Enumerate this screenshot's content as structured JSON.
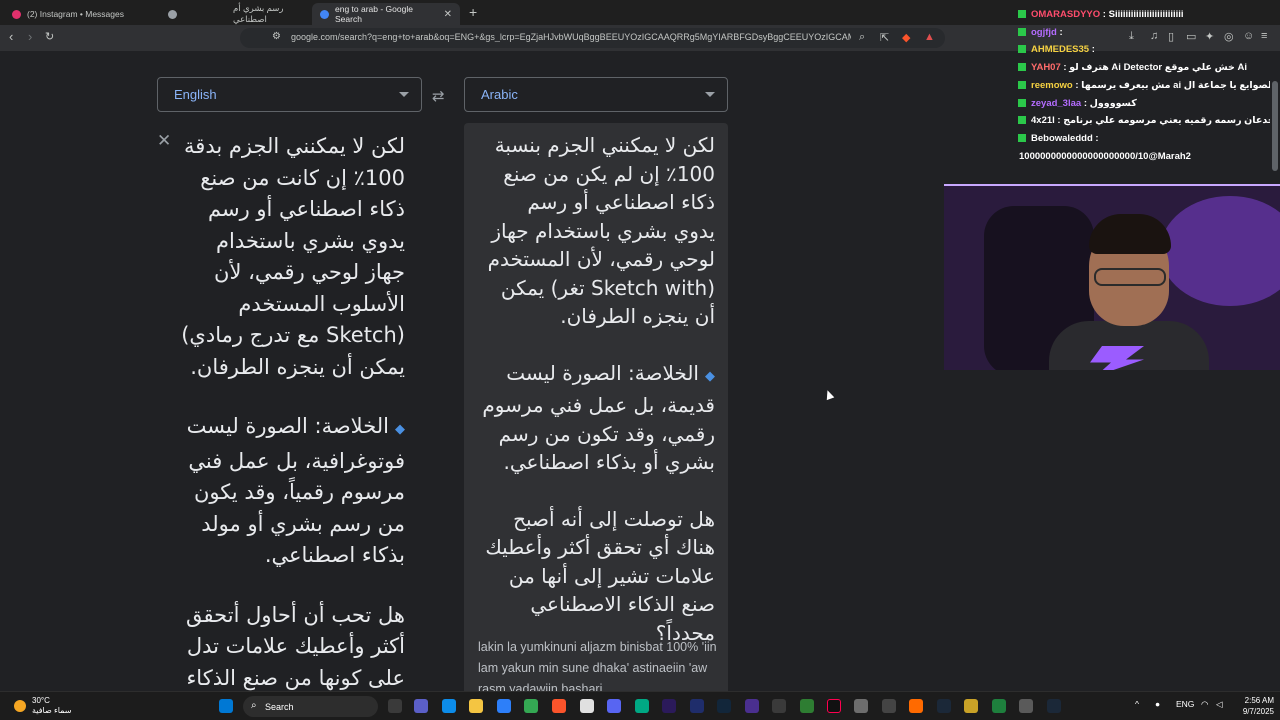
{
  "browser": {
    "tabs": [
      {
        "label": "(2) Instagram • Messages",
        "active": false,
        "favicon_color": "#e1306c"
      },
      {
        "label": "رسم بشري أم اصطناعي",
        "active": false,
        "favicon_color": "#9aa0a6"
      },
      {
        "label": "eng to arab - Google Search",
        "active": true,
        "favicon_color": "#4285f4"
      }
    ],
    "url": "google.com/search?q=eng+to+arab&oq=ENG+&gs_lcrp=EgZjaHJvbWUqBggBEEUYOzIGCAAQRRg5MgYIARBFGDsyBggCEEUYOzIGCAMQRRg7..."
  },
  "translator": {
    "source_lang": "English",
    "target_lang": "Arabic",
    "source_paragraphs": [
      "لكن لا يمكنني الجزم بدقة 100٪ إن كانت من صنع ذكاء اصطناعي أو رسم يدوي بشري باستخدام جهاز لوحي رقمي، لأن الأسلوب المستخدم (Sketch مع تدرج رمادي) يمكن أن ينجزه الطرفان.",
      "الخلاصة: الصورة ليست فوتوغرافية، بل عمل فني مرسوم رقمياً، وقد يكون من رسم بشري أو مولد بذكاء اصطناعي.",
      "هل تحب أن أحاول أتحقق أكثر وأعطيك علامات تدل على كونها من صنع الذكاء"
    ],
    "target_paragraphs": [
      "لكن لا يمكنني الجزم بنسبة 100٪ إن لم يكن من صنع ذكاء اصطناعي أو رسم يدوي بشري باستخدام جهاز لوحي رقمي، لأن المستخدم (Sketch with تغر) يمكن أن ينجزه الطرفان.",
      "الخلاصة: الصورة ليست قديمة، بل عمل فني مرسوم رقمي، وقد تكون من رسم بشري أو بذكاء اصطناعي.",
      "هل توصلت إلى أنه أصبح هناك أي تحقق أكثر وأعطيك علامات تشير إلى أنها من صنع الذكاء الاصطناعي محدداً؟"
    ],
    "transliteration": "lakin la yumkinuni aljazm binisbat 100% 'iin lam yakun min sune dhaka' astinaeiin 'aw rasm yadawiin bashari"
  },
  "chat": [
    {
      "user": "OMARASDYYO",
      "message": "Siiiiiiiiiiiiiiiiiiiiiiiiii",
      "color": "#ff4d6d"
    },
    {
      "user": "ogjfjd",
      "message": "",
      "color": "#b46cff"
    },
    {
      "user": "AHMEDES35",
      "message": "",
      "color": "#f5d142"
    },
    {
      "user": "YAH07",
      "message": "هترف لو Ai Detector خش علي موقع Ai",
      "color": "#ff6b6b"
    },
    {
      "user": "reemowo",
      "message": "مش بيعرف يرسمها ai الصوايع يا جماعة ال",
      "color": "#f5d142"
    },
    {
      "user": "zeyad_3laa",
      "message": "كسوووول",
      "color": "#b46cff"
    },
    {
      "user": "4x21l",
      "message": "يا جدعان رسمه رقميه يعني مرسومه علي برنامج",
      "color": "#ffffff"
    },
    {
      "user": "Bebowaleddd",
      "message": "",
      "color": "#ffffff"
    },
    {
      "user": "",
      "message": "1000000000000000000000/10@Marah2",
      "color": "#ffffff"
    }
  ],
  "taskbar": {
    "weather_temp": "30°C",
    "weather_desc": "سماء صافية",
    "search_label": "Search",
    "lang": "ENG",
    "time": "2:56 AM",
    "date": "9/7/2025"
  }
}
